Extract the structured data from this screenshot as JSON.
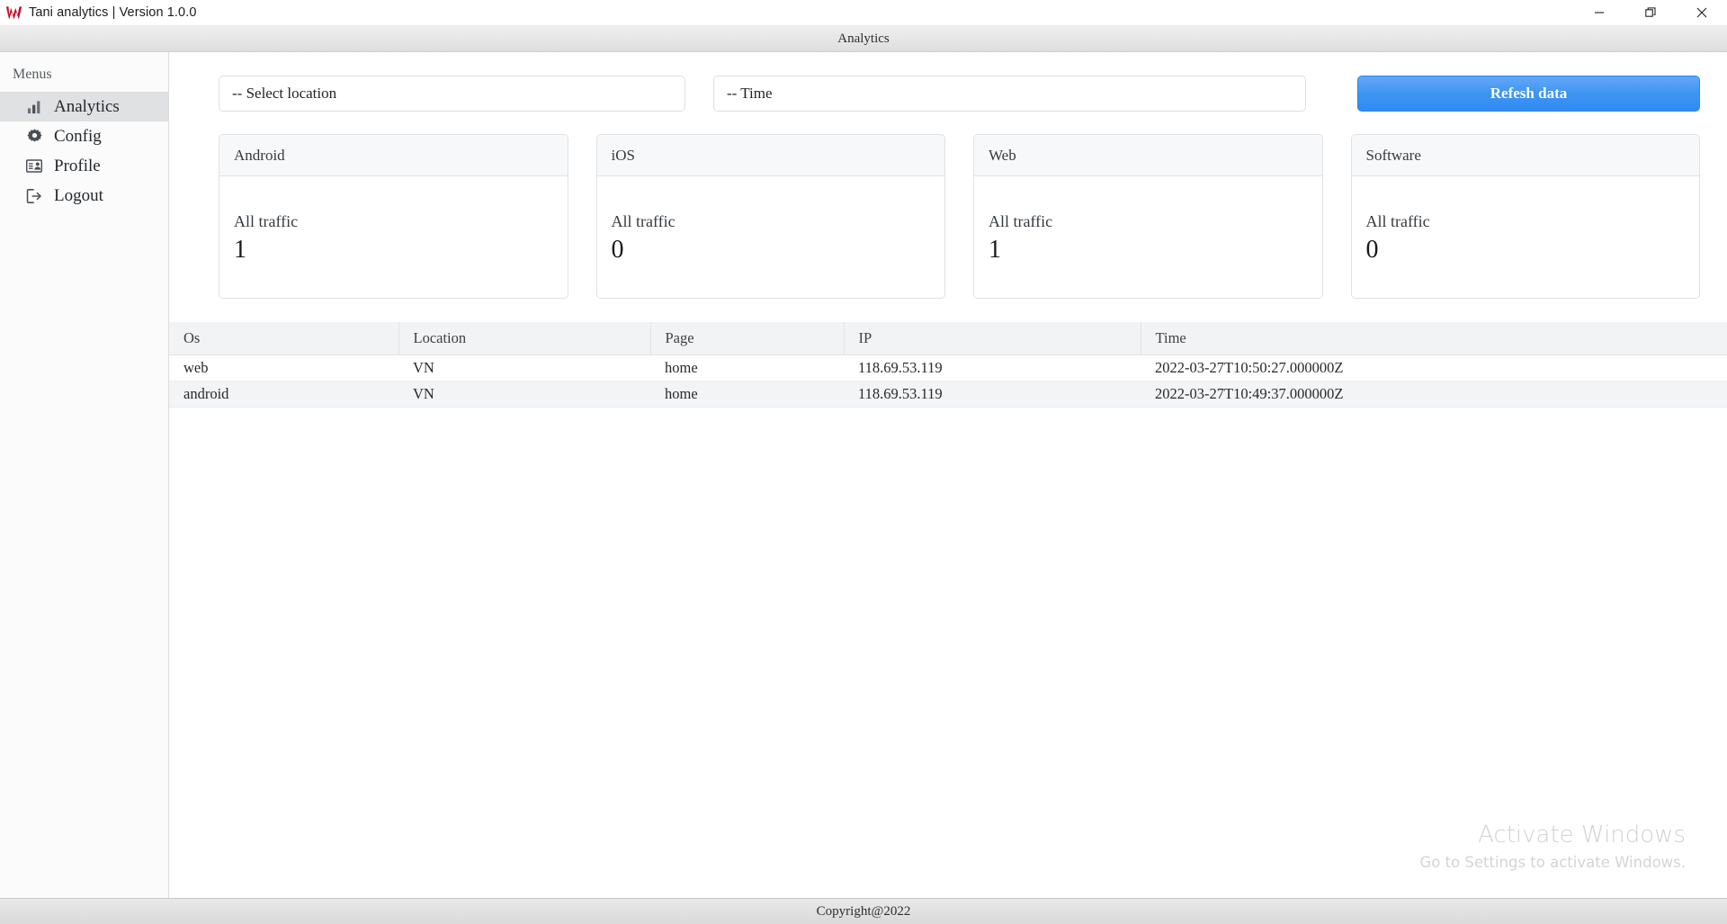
{
  "window": {
    "logo_icon": "tani-w-logo",
    "logo_color": "#c8102e",
    "title": "Tani analytics | Version 1.0.0",
    "controls": [
      {
        "name": "minimize",
        "icon": "minimize-icon",
        "glyph": "—"
      },
      {
        "name": "maximize",
        "icon": "restore-icon",
        "glyph": "❐"
      },
      {
        "name": "close",
        "icon": "close-icon",
        "glyph": "✕"
      }
    ]
  },
  "subheader": {
    "title": "Analytics"
  },
  "sidebar": {
    "section_label": "Menus",
    "items": [
      {
        "label": "Analytics",
        "icon": "bar-chart-icon",
        "active": true
      },
      {
        "label": "Config",
        "icon": "gear-icon",
        "active": false
      },
      {
        "label": "Profile",
        "icon": "id-card-icon",
        "active": false
      },
      {
        "label": "Logout",
        "icon": "sign-out-icon",
        "active": false
      }
    ]
  },
  "filters": {
    "location": {
      "value": "-- Select location",
      "placeholder": "-- Select location"
    },
    "time": {
      "value": "-- Time",
      "placeholder": "-- Time"
    },
    "refresh_label": "Refesh data",
    "refresh_color": "#3f95f3"
  },
  "cards": [
    {
      "title": "Android",
      "subtitle": "All traffic",
      "value": "1"
    },
    {
      "title": "iOS",
      "subtitle": "All traffic",
      "value": "0"
    },
    {
      "title": "Web",
      "subtitle": "All traffic",
      "value": "1"
    },
    {
      "title": "Software",
      "subtitle": "All traffic",
      "value": "0"
    }
  ],
  "table": {
    "columns": [
      "Os",
      "Location",
      "Page",
      "IP",
      "Time"
    ],
    "rows": [
      {
        "os": "web",
        "location": "VN",
        "page": "home",
        "ip": "118.69.53.119",
        "time": "2022-03-27T10:50:27.000000Z"
      },
      {
        "os": "android",
        "location": "VN",
        "page": "home",
        "ip": "118.69.53.119",
        "time": "2022-03-27T10:49:37.000000Z"
      }
    ]
  },
  "watermark": {
    "line1": "Activate Windows",
    "line2": "Go to Settings to activate Windows."
  },
  "footer": {
    "text": "Copyright@2022"
  }
}
